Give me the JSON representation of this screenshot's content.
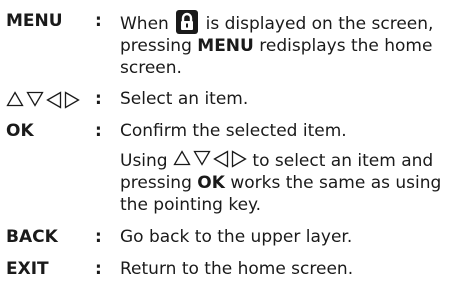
{
  "rows": {
    "menu": {
      "key": "MENU",
      "sep": ":",
      "text_before": "When",
      "text_after_icon": "is displayed on the screen, pressing",
      "bold_word": "MENU",
      "text_end": "redisplays the home screen."
    },
    "arrows": {
      "sep": ":",
      "text": "Select an item."
    },
    "ok": {
      "key": "OK",
      "sep": ":",
      "text": "Confirm the selected item.",
      "cont_before": "Using",
      "cont_mid": "to select an item and pressing",
      "cont_bold": "OK",
      "cont_end": "works the same as using the pointing key."
    },
    "back": {
      "key": "BACK",
      "sep": ":",
      "text": "Go back to the upper layer."
    },
    "exit": {
      "key": "EXIT",
      "sep": ":",
      "text": "Return to the home screen."
    }
  },
  "icons": {
    "lock": "lock-icon",
    "arrow_up": "arrow-up-icon",
    "arrow_down": "arrow-down-icon",
    "arrow_left": "arrow-left-icon",
    "arrow_right": "arrow-right-icon"
  }
}
